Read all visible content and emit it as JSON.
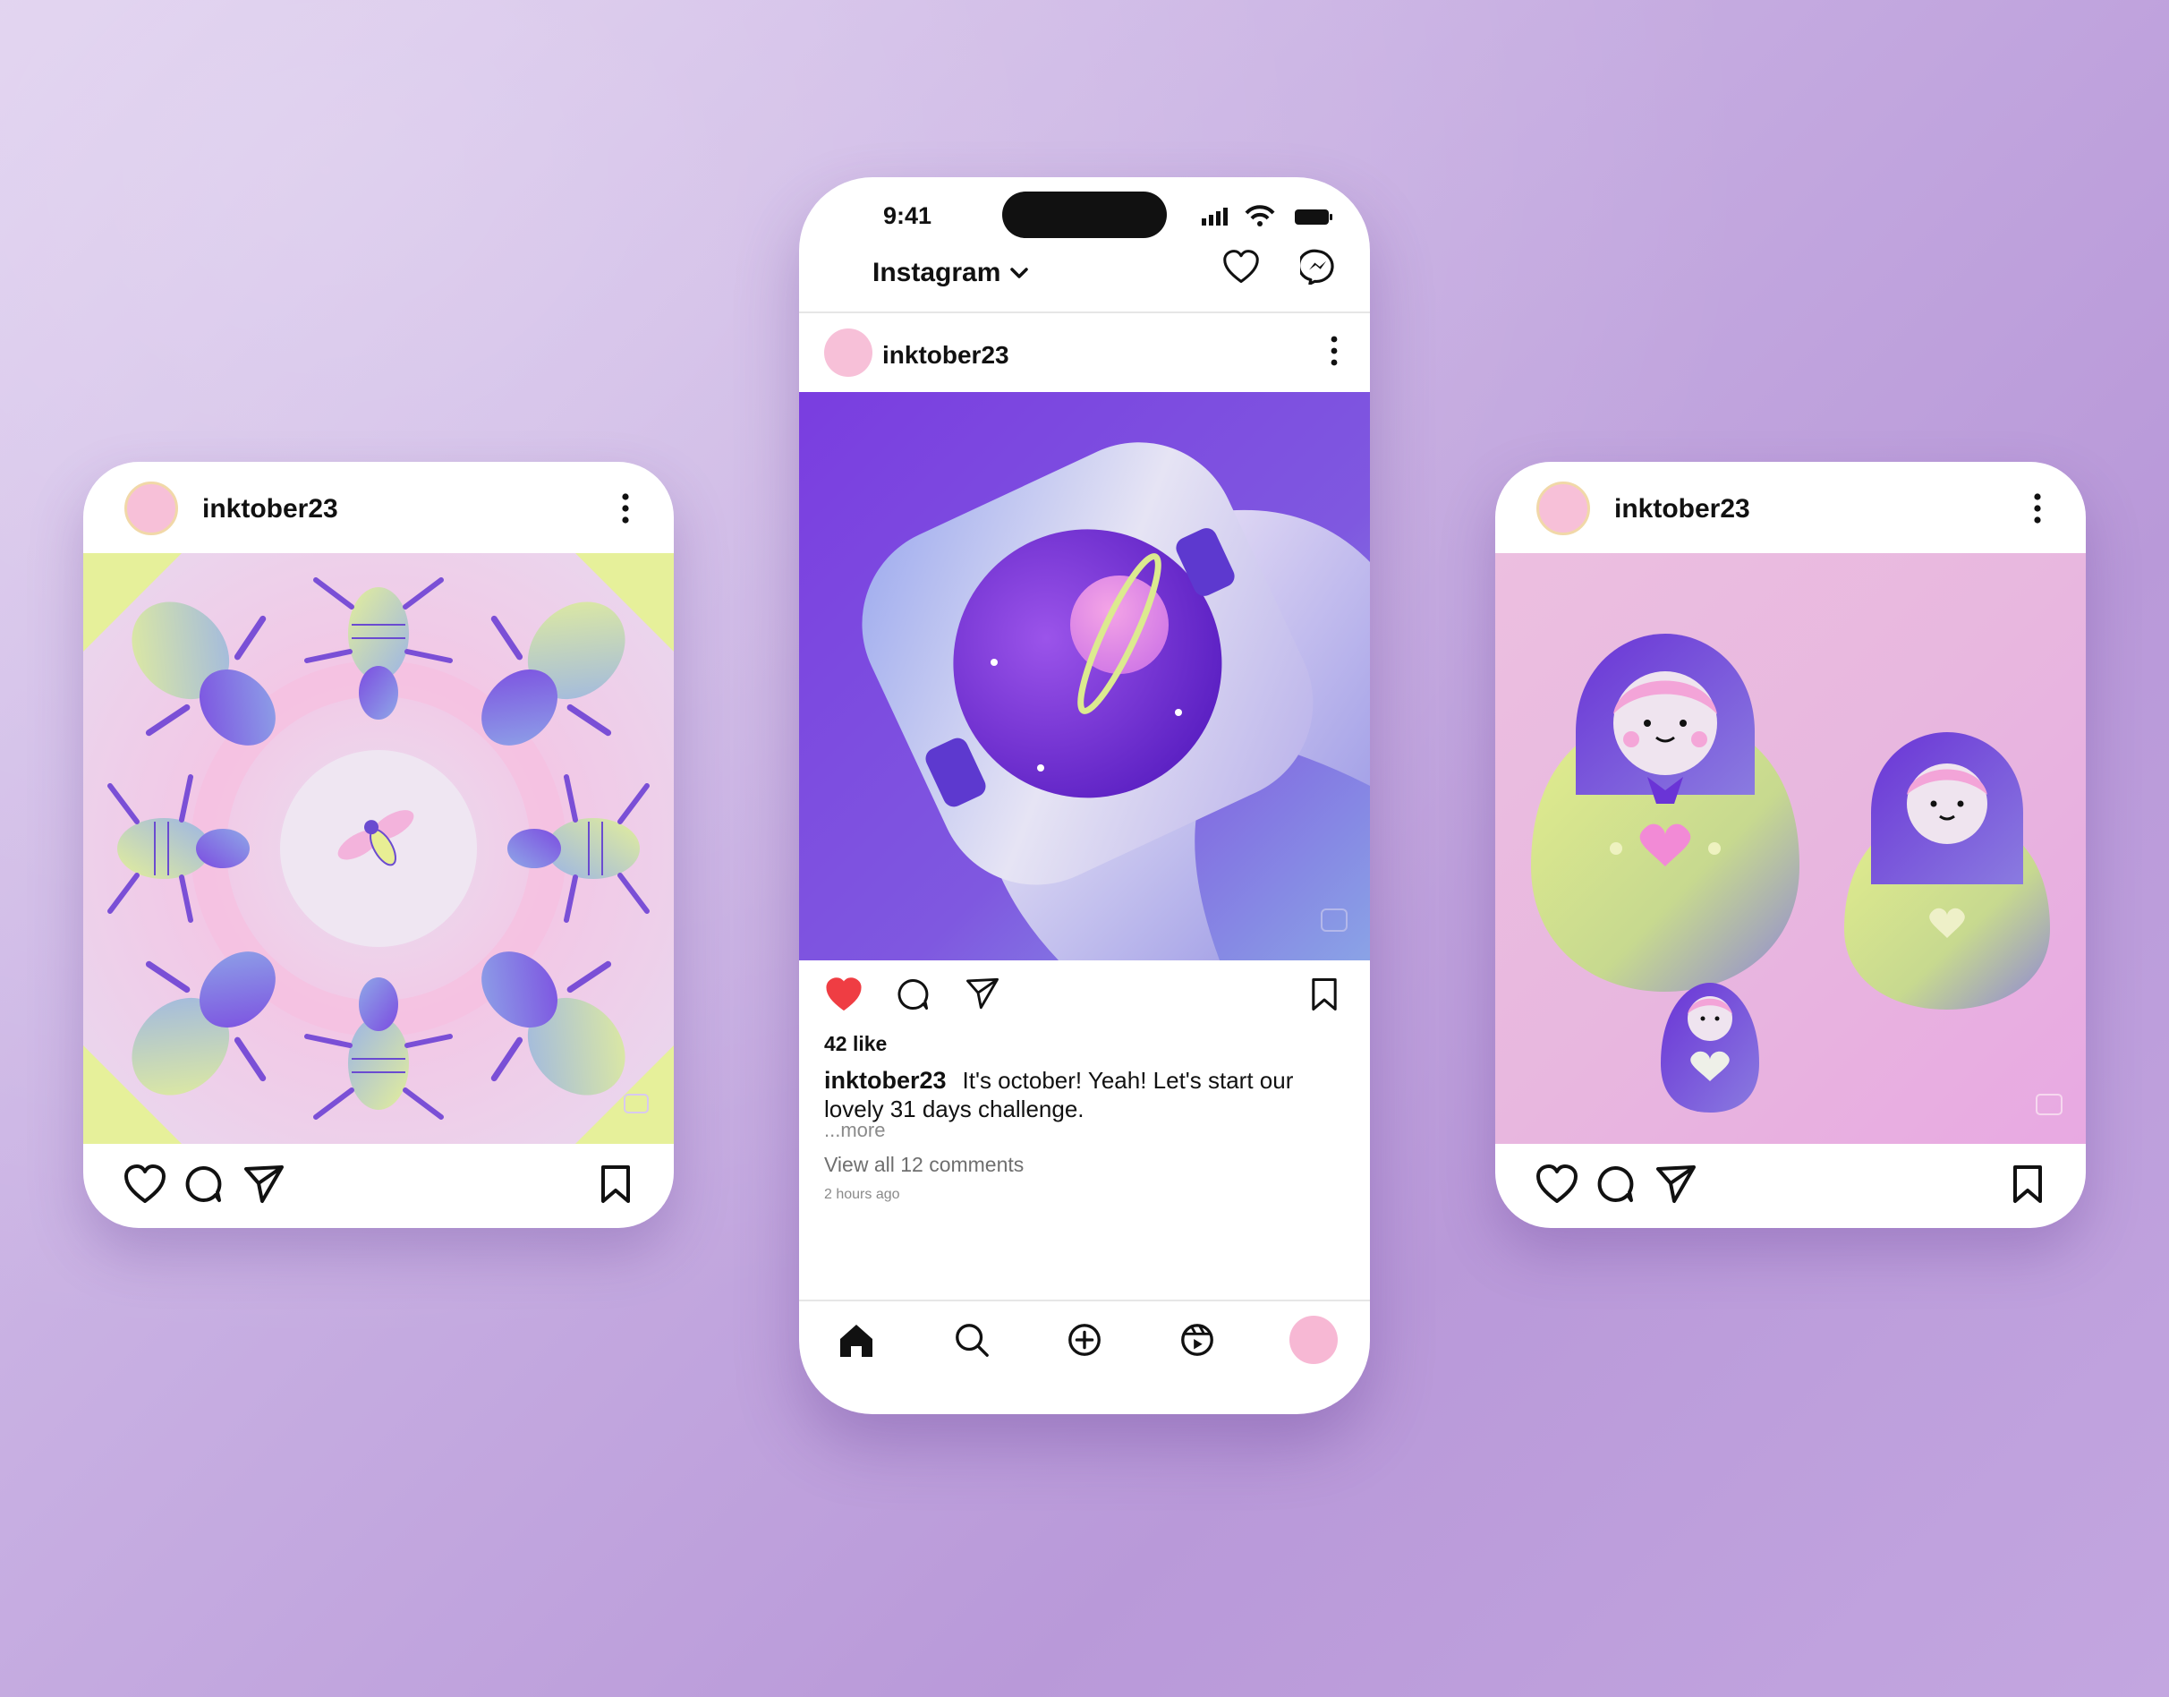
{
  "colors": {
    "background": "#c9b1e3",
    "avatar_pink": "#f7c0d8",
    "like_red": "#ef3d43",
    "text_dark": "#111111",
    "text_muted": "#8a8a8a"
  },
  "left_card": {
    "username": "inktober23",
    "image_alt": "kaleidoscope-beetles-illustration",
    "icons": [
      "heart-icon",
      "comment-icon",
      "share-icon",
      "bookmark-icon",
      "more-vertical-icon"
    ]
  },
  "right_card": {
    "username": "inktober23",
    "image_alt": "nesting-dolls-illustration",
    "icons": [
      "heart-icon",
      "comment-icon",
      "share-icon",
      "bookmark-icon",
      "more-vertical-icon"
    ]
  },
  "phone": {
    "status_time": "9:41",
    "app_title": "Instagram",
    "post": {
      "username": "inktober23",
      "image_alt": "astronaut-helmet-planet-illustration",
      "liked": true,
      "likes": "42 like",
      "caption_user": "inktober23",
      "caption_text": "It's october! Yeah! Let's start our lovely 31 days challenge.",
      "more_label": "...more",
      "comments_link": "View all 12 comments",
      "time_ago": "2 hours ago"
    },
    "nav": [
      "home-icon",
      "search-icon",
      "create-icon",
      "reels-icon",
      "profile-avatar"
    ]
  }
}
